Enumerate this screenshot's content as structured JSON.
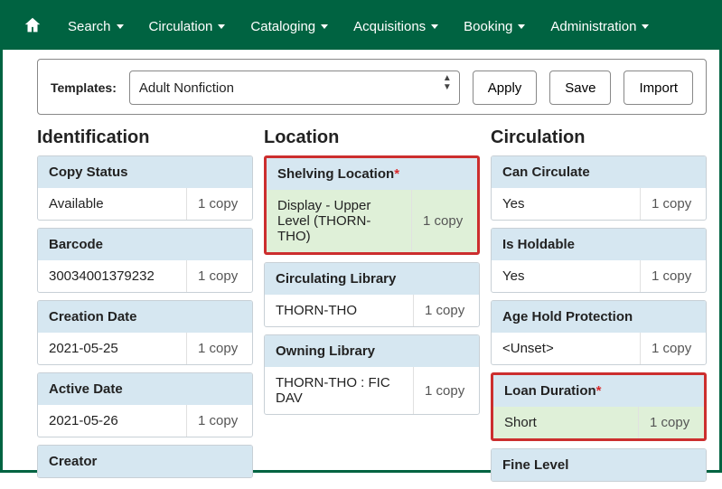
{
  "nav": {
    "items": [
      "Search",
      "Circulation",
      "Cataloging",
      "Acquisitions",
      "Booking",
      "Administration"
    ]
  },
  "templates": {
    "label": "Templates:",
    "selected": "Adult Nonfiction",
    "apply": "Apply",
    "save": "Save",
    "import": "Import"
  },
  "columns": {
    "identification": {
      "title": "Identification",
      "copy_status": {
        "header": "Copy Status",
        "value": "Available",
        "count": "1 copy"
      },
      "barcode": {
        "header": "Barcode",
        "value": "30034001379232",
        "count": "1 copy"
      },
      "creation_date": {
        "header": "Creation Date",
        "value": "2021-05-25",
        "count": "1 copy"
      },
      "active_date": {
        "header": "Active Date",
        "value": "2021-05-26",
        "count": "1 copy"
      },
      "creator": {
        "header": "Creator"
      }
    },
    "location": {
      "title": "Location",
      "shelving": {
        "header": "Shelving Location",
        "required": "*",
        "value": "Display - Upper Level (THORN-THO)",
        "count": "1 copy"
      },
      "circ_lib": {
        "header": "Circulating Library",
        "value": "THORN-THO",
        "count": "1 copy"
      },
      "owning_lib": {
        "header": "Owning Library",
        "value": "THORN-THO : FIC DAV",
        "count": "1 copy"
      }
    },
    "circulation": {
      "title": "Circulation",
      "can_circ": {
        "header": "Can Circulate",
        "value": "Yes",
        "count": "1 copy"
      },
      "holdable": {
        "header": "Is Holdable",
        "value": "Yes",
        "count": "1 copy"
      },
      "age_hold": {
        "header": "Age Hold Protection",
        "value": "<Unset>",
        "count": "1 copy"
      },
      "loan_dur": {
        "header": "Loan Duration",
        "required": "*",
        "value": "Short",
        "count": "1 copy"
      },
      "fine_level": {
        "header": "Fine Level"
      }
    }
  }
}
